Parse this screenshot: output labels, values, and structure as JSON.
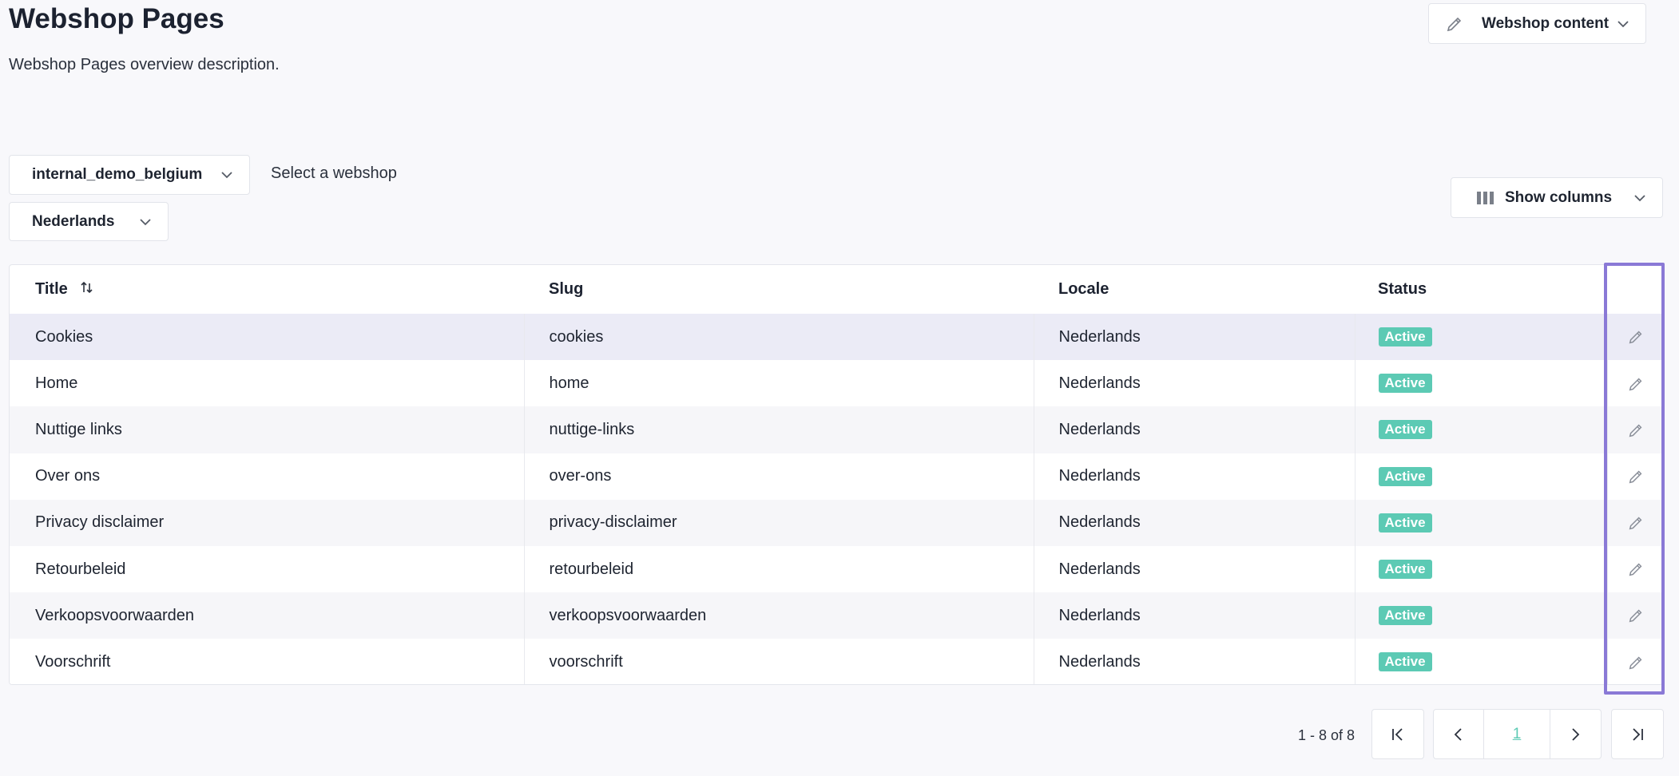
{
  "header": {
    "title": "Webshop Pages",
    "description": "Webshop Pages overview description.",
    "content_menu_label": "Webshop content"
  },
  "filters": {
    "webshop_value": "internal_demo_belgium",
    "webshop_hint": "Select a webshop",
    "language_value": "Nederlands",
    "show_columns_label": "Show columns"
  },
  "table": {
    "columns": [
      "Title",
      "Slug",
      "Locale",
      "Status"
    ],
    "rows": [
      {
        "title": "Cookies",
        "slug": "cookies",
        "locale": "Nederlands",
        "status": "Active"
      },
      {
        "title": "Home",
        "slug": "home",
        "locale": "Nederlands",
        "status": "Active"
      },
      {
        "title": "Nuttige links",
        "slug": "nuttige-links",
        "locale": "Nederlands",
        "status": "Active"
      },
      {
        "title": "Over ons",
        "slug": "over-ons",
        "locale": "Nederlands",
        "status": "Active"
      },
      {
        "title": "Privacy disclaimer",
        "slug": "privacy-disclaimer",
        "locale": "Nederlands",
        "status": "Active"
      },
      {
        "title": "Retourbeleid",
        "slug": "retourbeleid",
        "locale": "Nederlands",
        "status": "Active"
      },
      {
        "title": "Verkoopsvoorwaarden",
        "slug": "verkoopsvoorwaarden",
        "locale": "Nederlands",
        "status": "Active"
      },
      {
        "title": "Voorschrift",
        "slug": "voorschrift",
        "locale": "Nederlands",
        "status": "Active"
      }
    ]
  },
  "pagination": {
    "info": "1 - 8 of 8",
    "current_page": "1"
  },
  "colors": {
    "accent": "#5ccab4",
    "highlight": "#8a79d6",
    "background": "#f8f8fb"
  },
  "icons": {
    "content_menu": "pencil-icon",
    "dropdown": "chevron-down-icon",
    "columns": "columns-icon",
    "sort": "sort-icon",
    "row_action": "pencil-icon",
    "first_page": "first-page-icon",
    "prev_page": "chevron-left-icon",
    "next_page": "chevron-right-icon",
    "last_page": "last-page-icon"
  }
}
